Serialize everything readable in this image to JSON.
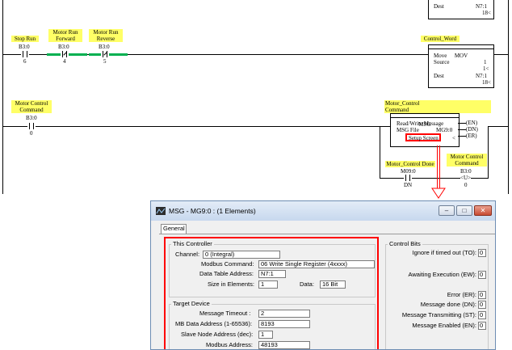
{
  "ladder": {
    "top_dest_label": "Dest",
    "top_dest_value": "N7:1",
    "top_dest_sub": "18<",
    "rung1": {
      "contacts": [
        {
          "tag_line1": "Stop Run",
          "tag_line2": "",
          "address": "B3:0",
          "bit": "6"
        },
        {
          "tag_line1": "Motor Run",
          "tag_line2": "Forward",
          "address": "B3:0",
          "bit": "4"
        },
        {
          "tag_line1": "Motor Run",
          "tag_line2": "Reverse",
          "address": "B3:0",
          "bit": "5"
        }
      ],
      "mov": {
        "tag": "Control_Word",
        "title": "MOV",
        "name": "Move",
        "source_label": "Source",
        "source_value": "1",
        "source_sub": "1<",
        "dest_label": "Dest",
        "dest_value": "N7:1",
        "dest_sub": "18<"
      }
    },
    "rung2": {
      "contact": {
        "tag_line1": "Motor Control",
        "tag_line2": "Command",
        "address": "B3:0",
        "bit": "0"
      },
      "msg": {
        "tag_line1": "Motor_Control",
        "tag_line2": "Command",
        "title": "MSG",
        "name": "Read/Write Message",
        "file_label": "MSG File",
        "file_value": "MG9:0",
        "setup_label": "Setup Screen",
        "en": "EN",
        "dn": "DN",
        "er": "ER",
        "arrow": "<"
      },
      "done_contact": {
        "tag": "Motor_Control Done",
        "address": "M09:0",
        "bit": "DN"
      },
      "coil": {
        "tag_line1": "Motor Control",
        "tag_line2": "Command",
        "address": "B3:0",
        "symbol": "U",
        "bit": "0"
      }
    }
  },
  "dialog": {
    "title": "MSG - MG9:0 : (1 Elements)",
    "tab": "General",
    "this_controller": {
      "group_title": "This Controller",
      "channel_label": "Channel:",
      "channel_value": "0 (Integral)",
      "modbus_command_label": "Modbus Command:",
      "modbus_command_value": "06 Write Single Register (4xxxx)",
      "data_table_address_label": "Data Table Address:",
      "data_table_address_value": "N7:1",
      "size_label": "Size in Elements:",
      "size_value": "1",
      "data_label": "Data:",
      "data_value": "16 Bit"
    },
    "target_device": {
      "group_title": "Target Device",
      "timeout_label": "Message Timeout :",
      "timeout_value": "2",
      "mb_address_label": "MB Data Address (1-65536):",
      "mb_address_value": "8193",
      "slave_label": "Slave Node Address (dec):",
      "slave_value": "1",
      "modbus_address_label": "Modbus Address:",
      "modbus_address_value": "48193"
    },
    "control_bits": {
      "group_title": "Control Bits",
      "bits": [
        {
          "label": "Ignore if timed out (TO):",
          "value": "0"
        },
        {
          "label": "Awaiting Execution (EW):",
          "value": "0"
        },
        {
          "label": "Error (ER):",
          "value": "0"
        },
        {
          "label": "Message done (DN):",
          "value": "0"
        },
        {
          "label": "Message Transmitting (ST):",
          "value": "0"
        },
        {
          "label": "Message Enabled (EN):",
          "value": "0"
        }
      ]
    },
    "buttons": {
      "minimize": "–",
      "maximize": "□",
      "close": "✕"
    }
  },
  "colors": {
    "highlight": "#ff0000",
    "tag_bg": "#ffff66",
    "energized": "#00b050"
  }
}
